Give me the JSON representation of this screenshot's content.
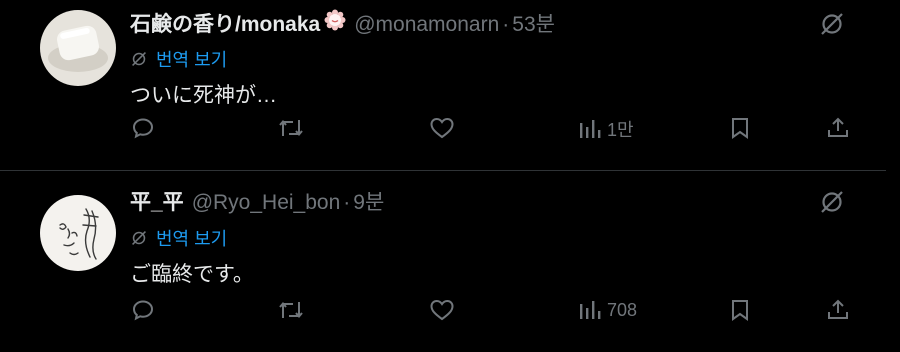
{
  "tweets": [
    {
      "name": "石鹸の香り/monaka",
      "handle": "@monamonarn",
      "separator": "·",
      "time": "53분",
      "translate_label": "번역 보기",
      "text": "ついに死神が…",
      "views": "1만"
    },
    {
      "name": "平_平",
      "handle": "@Ryo_Hei_bon",
      "separator": "·",
      "time": "9분",
      "translate_label": "번역 보기",
      "text": "ご臨終です。",
      "views": "708"
    }
  ],
  "colors": {
    "background": "#000000",
    "text": "#e7e9ea",
    "muted": "#71767b",
    "link": "#1d9bf0",
    "divider": "#2f3336"
  },
  "icons": [
    "grok-icon",
    "translate-icon",
    "reply-icon",
    "retweet-icon",
    "like-icon",
    "views-icon",
    "bookmark-icon",
    "share-icon",
    "flower-icon"
  ]
}
